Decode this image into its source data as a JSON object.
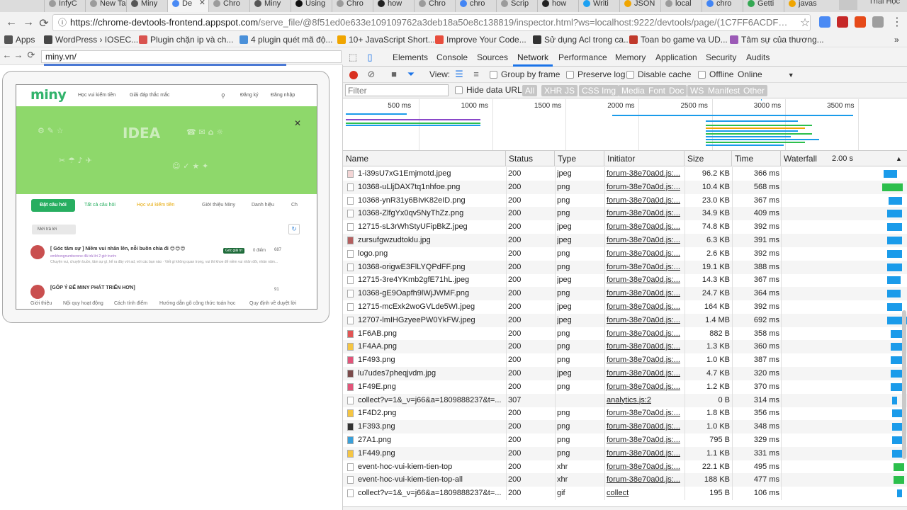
{
  "browser": {
    "tabs": [
      {
        "label": "InfyC",
        "fav": "#9b9b9b"
      },
      {
        "label": "New Tab",
        "fav": "#9b9b9b"
      },
      {
        "label": "Miny",
        "fav": "#555555"
      },
      {
        "label": "De",
        "fav": "#4a8af4",
        "active": true
      },
      {
        "label": "Chro",
        "fav": "#9b9b9b"
      },
      {
        "label": "Miny",
        "fav": "#555555"
      },
      {
        "label": "Using",
        "fav": "#111111"
      },
      {
        "label": "Chro",
        "fav": "#9b9b9b"
      },
      {
        "label": "how",
        "fav": "#222222"
      },
      {
        "label": "Chro",
        "fav": "#9b9b9b"
      },
      {
        "label": "chro",
        "fav": "#4285f4"
      },
      {
        "label": "Scrip",
        "fav": "#9b9b9b"
      },
      {
        "label": "how",
        "fav": "#222222"
      },
      {
        "label": "Writi",
        "fav": "#1da1f2"
      },
      {
        "label": "JSON",
        "fav": "#f0a500"
      },
      {
        "label": "local",
        "fav": "#9b9b9b"
      },
      {
        "label": "chro",
        "fav": "#4285f4"
      },
      {
        "label": "Getti",
        "fav": "#34a853"
      },
      {
        "label": "javas",
        "fav": "#f0a500"
      }
    ],
    "profile_name": "Thai Học",
    "url_host": "https://chrome-devtools-frontend.appspot.com",
    "url_rest": "/serve_file/@8f51ed0e633e109109762a3deb18a50e8c138819/inspector.html?ws=localhost:9222/devtools/page/(1C7FF6ACDF…",
    "bookmarks": [
      {
        "label": "Apps",
        "color": "#555555"
      },
      {
        "label": "WordPress › IOSEC...",
        "color": "#464646"
      },
      {
        "label": "Plugin chặn ip và ch...",
        "color": "#d9534f"
      },
      {
        "label": "4 plugin quét mã độ...",
        "color": "#4a90d9"
      },
      {
        "label": "10+ JavaScript Short...",
        "color": "#f0a500"
      },
      {
        "label": "Improve Your Code...",
        "color": "#e84d3d"
      },
      {
        "label": "Sử dụng Acl trong ca...",
        "color": "#333333"
      },
      {
        "label": "Toan bo game va UD...",
        "color": "#c0392b"
      },
      {
        "label": "Tâm sự của thương...",
        "color": "#9b59b6"
      }
    ]
  },
  "emulator": {
    "url": "miny.vn/",
    "site": {
      "logo": "miny",
      "header_links": [
        "Học vui kiếm tiền",
        "Giải đáp thắc mắc",
        "Đăng ký",
        "Đăng nhập"
      ],
      "banner_text": "IDEA",
      "ask_button": "Đặt câu hỏi",
      "nav_links": [
        "Tất cả câu hỏi",
        "Học vui kiếm tiền",
        "Giới thiệu Miny",
        "Danh hiệu",
        "Ch"
      ],
      "filter": "Mới trả lời",
      "posts": [
        {
          "title": "[ Góc tâm sự ] Niềm vui nhân lên, nỗi buồn chia đi 😍😍😍",
          "meta": "emkhongnumberone đã trả lời 2 giờ trước",
          "desc": "Chuyện vui, chuyện buồn, tâm sự gì, kể ra đây với ad, với các bạn nào · Viết gì không quan trọng, vui thì khoe để niềm vui nhân đôi, nhân năm...",
          "badge": "Góc giải trí",
          "points": "0 điểm",
          "count": "687"
        },
        {
          "title": "[GÓP Ý ĐỂ MINY PHÁT TRIỂN HƠN]",
          "meta": "",
          "desc": "",
          "badge": "",
          "points": "",
          "count": "91"
        }
      ],
      "footer_links": [
        "Giới thiệu",
        "Nội quy hoạt động",
        "Cách tính điểm",
        "Hướng dẫn gõ công thức toán học",
        "Quy định về duyệt lời"
      ]
    }
  },
  "devtools": {
    "tabs": [
      "Elements",
      "Console",
      "Sources",
      "Network",
      "Performance",
      "Memory",
      "Application",
      "Security",
      "Audits"
    ],
    "active_tab": "Network",
    "toolbar": {
      "view_label": "View:",
      "group_by_frame": "Group by frame",
      "preserve_log": "Preserve log",
      "disable_cache": "Disable cache",
      "offline": "Offline",
      "throttle": "Online"
    },
    "filter_placeholder": "Filter",
    "hide_data_urls": "Hide data URLs",
    "type_filters": [
      "All",
      "XHR",
      "JS",
      "CSS",
      "Img",
      "Media",
      "Font",
      "Doc",
      "WS",
      "Manifest",
      "Other"
    ],
    "overview_ticks": [
      "500 ms",
      "1000 ms",
      "1500 ms",
      "2000 ms",
      "2500 ms",
      "3000 ms",
      "3500 ms"
    ],
    "columns": {
      "name": "Name",
      "status": "Status",
      "type": "Type",
      "initiator": "Initiator",
      "size": "Size",
      "time": "Time",
      "waterfall": "Waterfall",
      "waterfall_scale": "2.00 s"
    },
    "requests": [
      {
        "name": "1-i39sU7xG1Emjmotd.jpeg",
        "status": "200",
        "type": "jpeg",
        "initiator": "forum-38e70a0d.js:...",
        "size": "96.2 KB",
        "time": "366 ms",
        "wf_start": 0.83,
        "wf_len": 0.11,
        "icon": "#f3d5d5"
      },
      {
        "name": "10368-uLljDAX7tq1nhfoe.png",
        "status": "200",
        "type": "png",
        "initiator": "forum-38e70a0d.js:...",
        "size": "10.4 KB",
        "time": "568 ms",
        "wf_start": 0.82,
        "wf_len": 0.17,
        "icon": "#ffffff",
        "wf_green": true
      },
      {
        "name": "10368-ynR31y6BIvK82eID.png",
        "status": "200",
        "type": "png",
        "initiator": "forum-38e70a0d.js:...",
        "size": "23.0 KB",
        "time": "367 ms",
        "wf_start": 0.87,
        "wf_len": 0.11,
        "icon": "#ffffff"
      },
      {
        "name": "10368-ZlfgYx0qv5NyThZz.png",
        "status": "200",
        "type": "png",
        "initiator": "forum-38e70a0d.js:...",
        "size": "34.9 KB",
        "time": "409 ms",
        "wf_start": 0.86,
        "wf_len": 0.12,
        "icon": "#ffffff"
      },
      {
        "name": "12715-sL3rWhStyUFipBkZ.jpeg",
        "status": "200",
        "type": "jpeg",
        "initiator": "forum-38e70a0d.js:...",
        "size": "74.8 KB",
        "time": "392 ms",
        "wf_start": 0.86,
        "wf_len": 0.12,
        "icon": "#ffffff"
      },
      {
        "name": "zursufgwzudtoklu.jpg",
        "status": "200",
        "type": "jpeg",
        "initiator": "forum-38e70a0d.js:...",
        "size": "6.3 KB",
        "time": "391 ms",
        "wf_start": 0.86,
        "wf_len": 0.12,
        "icon": "#b45f5f"
      },
      {
        "name": "logo.png",
        "status": "200",
        "type": "png",
        "initiator": "forum-38e70a0d.js:...",
        "size": "2.6 KB",
        "time": "392 ms",
        "wf_start": 0.86,
        "wf_len": 0.12,
        "icon": "#ffffff"
      },
      {
        "name": "10368-origwE3FlLYQPdFF.png",
        "status": "200",
        "type": "png",
        "initiator": "forum-38e70a0d.js:...",
        "size": "19.1 KB",
        "time": "388 ms",
        "wf_start": 0.86,
        "wf_len": 0.12,
        "icon": "#ffffff"
      },
      {
        "name": "12715-3re4YKmb2gfE71hL.jpeg",
        "status": "200",
        "type": "jpeg",
        "initiator": "forum-38e70a0d.js:...",
        "size": "14.3 KB",
        "time": "367 ms",
        "wf_start": 0.86,
        "wf_len": 0.11,
        "icon": "#ffffff"
      },
      {
        "name": "10368-gE9Oapfh9lWjJWMF.png",
        "status": "200",
        "type": "png",
        "initiator": "forum-38e70a0d.js:...",
        "size": "24.7 KB",
        "time": "364 ms",
        "wf_start": 0.86,
        "wf_len": 0.11,
        "icon": "#ffffff"
      },
      {
        "name": "12715-mcExk2woGVLde5WI.jpeg",
        "status": "200",
        "type": "jpeg",
        "initiator": "forum-38e70a0d.js:...",
        "size": "164 KB",
        "time": "392 ms",
        "wf_start": 0.86,
        "wf_len": 0.12,
        "icon": "#ffffff"
      },
      {
        "name": "12707-lmIHGzyeePW0YkFW.jpeg",
        "status": "200",
        "type": "jpeg",
        "initiator": "forum-38e70a0d.js:...",
        "size": "1.4 MB",
        "time": "692 ms",
        "wf_start": 0.86,
        "wf_len": 0.21,
        "icon": "#ffffff"
      },
      {
        "name": "1F6AB.png",
        "status": "200",
        "type": "png",
        "initiator": "forum-38e70a0d.js:...",
        "size": "882 B",
        "time": "358 ms",
        "wf_start": 0.89,
        "wf_len": 0.11,
        "icon": "#e25555"
      },
      {
        "name": "1F4AA.png",
        "status": "200",
        "type": "png",
        "initiator": "forum-38e70a0d.js:...",
        "size": "1.3 KB",
        "time": "360 ms",
        "wf_start": 0.89,
        "wf_len": 0.11,
        "icon": "#f5c542"
      },
      {
        "name": "1F493.png",
        "status": "200",
        "type": "png",
        "initiator": "forum-38e70a0d.js:...",
        "size": "1.0 KB",
        "time": "387 ms",
        "wf_start": 0.89,
        "wf_len": 0.11,
        "icon": "#e2557a"
      },
      {
        "name": "lu7udes7pheqjvdm.jpg",
        "status": "200",
        "type": "jpeg",
        "initiator": "forum-38e70a0d.js:...",
        "size": "4.7 KB",
        "time": "320 ms",
        "wf_start": 0.89,
        "wf_len": 0.1,
        "icon": "#7a4a4a"
      },
      {
        "name": "1F49E.png",
        "status": "200",
        "type": "png",
        "initiator": "forum-38e70a0d.js:...",
        "size": "1.2 KB",
        "time": "370 ms",
        "wf_start": 0.89,
        "wf_len": 0.11,
        "icon": "#e2557a"
      },
      {
        "name": "collect?v=1&_v=j66&a=1809888237&t=...",
        "status": "307",
        "type": "",
        "initiator": "analytics.js:2",
        "size": "0 B",
        "time": "314 ms",
        "wf_start": 0.9,
        "wf_len": 0.04,
        "icon": "#ffffff"
      },
      {
        "name": "1F4D2.png",
        "status": "200",
        "type": "png",
        "initiator": "forum-38e70a0d.js:...",
        "size": "1.8 KB",
        "time": "356 ms",
        "wf_start": 0.9,
        "wf_len": 0.11,
        "icon": "#f5c542"
      },
      {
        "name": "1F393.png",
        "status": "200",
        "type": "png",
        "initiator": "forum-38e70a0d.js:...",
        "size": "1.0 KB",
        "time": "348 ms",
        "wf_start": 0.9,
        "wf_len": 0.11,
        "icon": "#333333"
      },
      {
        "name": "27A1.png",
        "status": "200",
        "type": "png",
        "initiator": "forum-38e70a0d.js:...",
        "size": "795 B",
        "time": "329 ms",
        "wf_start": 0.9,
        "wf_len": 0.1,
        "icon": "#3aa0d9"
      },
      {
        "name": "1F449.png",
        "status": "200",
        "type": "png",
        "initiator": "forum-38e70a0d.js:...",
        "size": "1.1 KB",
        "time": "331 ms",
        "wf_start": 0.9,
        "wf_len": 0.1,
        "icon": "#f5c542"
      },
      {
        "name": "event-hoc-vui-kiem-tien-top",
        "status": "200",
        "type": "xhr",
        "initiator": "forum-38e70a0d.js:...",
        "size": "22.1 KB",
        "time": "495 ms",
        "wf_start": 0.91,
        "wf_len": 0.09,
        "icon": "#ffffff",
        "wf_green": true
      },
      {
        "name": "event-hoc-vui-kiem-tien-top-all",
        "status": "200",
        "type": "xhr",
        "initiator": "forum-38e70a0d.js:...",
        "size": "188 KB",
        "time": "477 ms",
        "wf_start": 0.91,
        "wf_len": 0.09,
        "icon": "#ffffff",
        "wf_green": true
      },
      {
        "name": "collect?v=1&_v=j66&a=1809888237&t=...",
        "status": "200",
        "type": "gif",
        "initiator": "collect",
        "size": "195 B",
        "time": "106 ms",
        "wf_start": 0.94,
        "wf_len": 0.04,
        "icon": "#ffffff"
      }
    ]
  },
  "colors": {
    "accent": "#1a73e8",
    "record": "#d9301f",
    "waterfall_blue": "#1a9bea",
    "waterfall_green": "#2cbf4c",
    "site_green": "#27ae60"
  }
}
